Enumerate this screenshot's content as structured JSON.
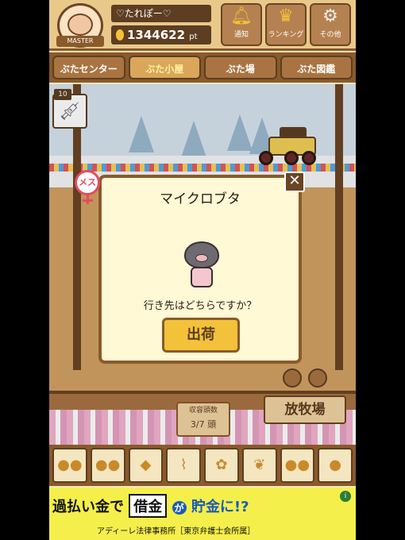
{
  "header": {
    "user_name": "♡たれぽー♡",
    "coins": "1344622",
    "coin_unit": "pt",
    "avatar_badge": "MASTER",
    "buttons": [
      {
        "label": "通知",
        "icon": "bell-icon"
      },
      {
        "label": "ランキング",
        "icon": "crown-icon"
      },
      {
        "label": "その他",
        "icon": "gear-icon"
      }
    ]
  },
  "tabs": [
    {
      "label": "ぶたセンター",
      "active": false
    },
    {
      "label": "ぶた小屋",
      "active": true
    },
    {
      "label": "ぶた場",
      "active": false
    },
    {
      "label": "ぶた図鑑",
      "active": false
    }
  ],
  "scene": {
    "syringe_count": "10",
    "capacity_label": "収容頭数",
    "capacity_value": "3/7 頭",
    "pasture_sign": "放牧場"
  },
  "dialog": {
    "gender": "メス",
    "title": "マイクロブタ",
    "question": "行き先はどちらですか？",
    "ship_button": "出荷",
    "close": "✕"
  },
  "feed_items": [
    "●●",
    "●●",
    "◆",
    "⌇",
    "✿",
    "❦",
    "●●",
    "●"
  ],
  "ad": {
    "part1": "過払い金で",
    "part2": "借金",
    "part3": "が",
    "part4": "貯金に!?",
    "sub": "アディーレ法律事務所［東京弁護士会所属］",
    "info": "i"
  }
}
